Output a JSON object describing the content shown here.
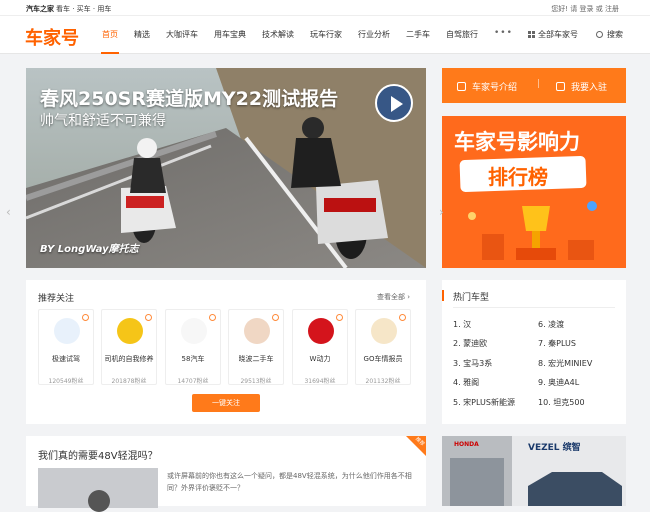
{
  "topbar": {
    "brand": "汽车之家",
    "links": "看车 · 买车 · 用车",
    "user": "您好! 请 登录 或 注册"
  },
  "nav": {
    "logo": "车家号",
    "items": [
      "首页",
      "精选",
      "大咖评车",
      "用车宝典",
      "技术解读",
      "玩车行家",
      "行业分析",
      "二手车",
      "自驾旅行"
    ],
    "active_index": 0,
    "more": "•••",
    "all_label": "全部车家号",
    "search_label": "搜索"
  },
  "hero": {
    "title": "春风250SR赛道版MY22测试报告",
    "subtitle": "帅气和舒适不可兼得",
    "credit": "BY LongWay摩托志",
    "slides": 7,
    "active_slide": 0
  },
  "side_actions": {
    "intro": "车家号介绍",
    "join": "我要入驻",
    "separator": "|"
  },
  "rank_ad": {
    "line1": "车家号影响力",
    "line2": "排行榜"
  },
  "arrows": {
    "left": "‹",
    "right": "›"
  },
  "follow": {
    "title": "推荐关注",
    "view_all": "查看全部 ›",
    "button": "一键关注",
    "cards": [
      {
        "name": "极速试驾",
        "fans": "120549粉丝",
        "color": "#e8f1fb"
      },
      {
        "name": "司机的自我修养",
        "fans": "201878粉丝",
        "color": "#f5c518"
      },
      {
        "name": "58汽车",
        "fans": "14707粉丝",
        "color": "#f7f7f7"
      },
      {
        "name": "晓波二手车",
        "fans": "29513粉丝",
        "color": "#f0d7c4"
      },
      {
        "name": "W动力",
        "fans": "31694粉丝",
        "color": "#d4141c"
      },
      {
        "name": "GO车情报员",
        "fans": "201132粉丝",
        "color": "#f6e6c8"
      }
    ]
  },
  "hot_models": {
    "title": "热门车型",
    "items": [
      "1. 汉",
      "6. 凌渡",
      "2. 蒙迪欧",
      "7. 秦PLUS",
      "3. 宝马3系",
      "8. 宏光MINIEV",
      "4. 雅阁",
      "9. 奥迪A4L",
      "5. 宋PLUS新能源",
      "10. 坦克500"
    ]
  },
  "article": {
    "title": "我们真的需要48V轻混吗？",
    "snippet": "或许屏幕前的你也有这么一个疑问，都是48V轻混系统，为什么他们作用各不相同？外界评价褒贬不一？",
    "corner": "推荐"
  },
  "car_ad": {
    "brand": "HONDA",
    "model": "VEZEL 缤智"
  }
}
